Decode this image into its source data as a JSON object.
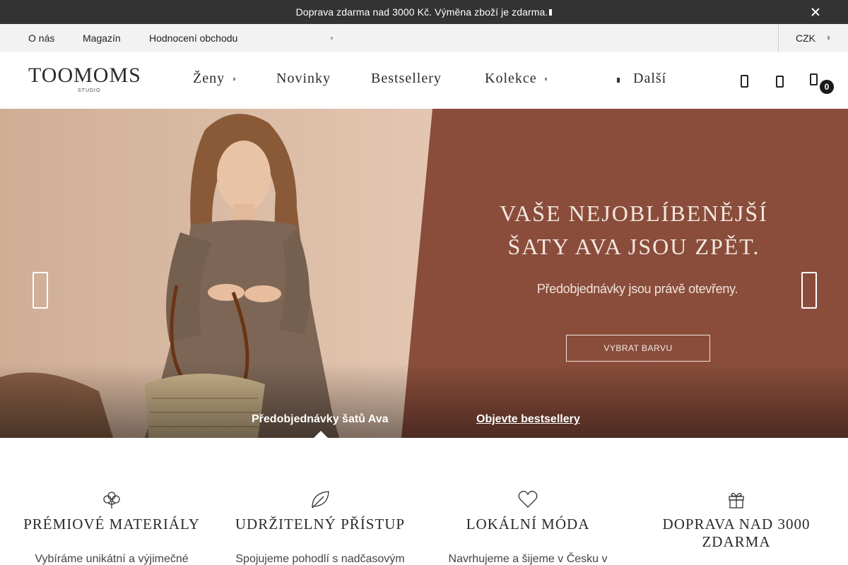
{
  "announcement": {
    "text": "Doprava zdarma nad 3000 Kč. Výměna zboží je zdarma. ",
    "close_icon": "close-icon"
  },
  "topbar": {
    "links": [
      "O nás",
      "Magazín",
      "Hodnocení obchodu"
    ],
    "currency": "CZK"
  },
  "header": {
    "logo_word": "TOOMOMS",
    "logo_sub": "STUDIO",
    "nav": [
      "Ženy",
      "Novinky",
      "Bestsellery",
      "Kolekce"
    ],
    "more": "Další",
    "cart_count": "0"
  },
  "hero": {
    "title_line1": "VAŠE NEJOBLÍBENĚJŠÍ",
    "title_line2": "ŠATY AVA JSOU ZPĚT.",
    "subtitle": "Předobjednávky jsou právě otevřeny.",
    "button": "VYBRAT BARVU",
    "slides": [
      "Předobjednávky šatů Ava",
      "Objevte bestsellery"
    ],
    "colors": {
      "background": "#8a4d3b",
      "photo_bg": "#d9b9a2"
    }
  },
  "features": [
    {
      "icon": "cotton-icon",
      "title": "PRÉMIOVÉ MATERIÁLY",
      "desc": "Vybíráme unikátní a výjimečné"
    },
    {
      "icon": "leaf-icon",
      "title": "UDRŽITELNÝ PŘÍSTUP",
      "desc": "Spojujeme pohodlí s nadčasovým"
    },
    {
      "icon": "heart-icon",
      "title": "LOKÁLNÍ MÓDA",
      "desc": "Navrhujeme a šijeme v Česku v"
    },
    {
      "icon": "gift-icon",
      "title": "DOPRAVA NAD 3000 ZDARMA",
      "desc": ""
    }
  ]
}
